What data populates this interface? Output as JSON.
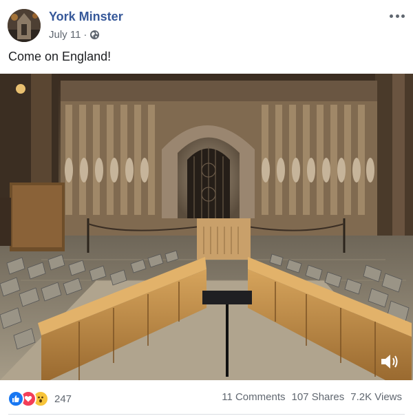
{
  "post": {
    "page_name": "York Minster",
    "date": "July 11",
    "separator": "·",
    "text": "Come on England!",
    "privacy_icon": "globe-icon",
    "menu_icon": "more-options-icon"
  },
  "video": {
    "volume_icon": "volume-icon"
  },
  "reactions": {
    "types": [
      "like",
      "love",
      "wow"
    ],
    "count": "247"
  },
  "stats": {
    "comments": "11 Comments",
    "shares": "107 Shares",
    "views": "7.2K Views"
  },
  "colors": {
    "link_blue": "#365899",
    "meta_gray": "#606770",
    "like_blue": "#1877f2",
    "love_red": "#f33e58",
    "wow_yellow": "#f7c43a"
  }
}
